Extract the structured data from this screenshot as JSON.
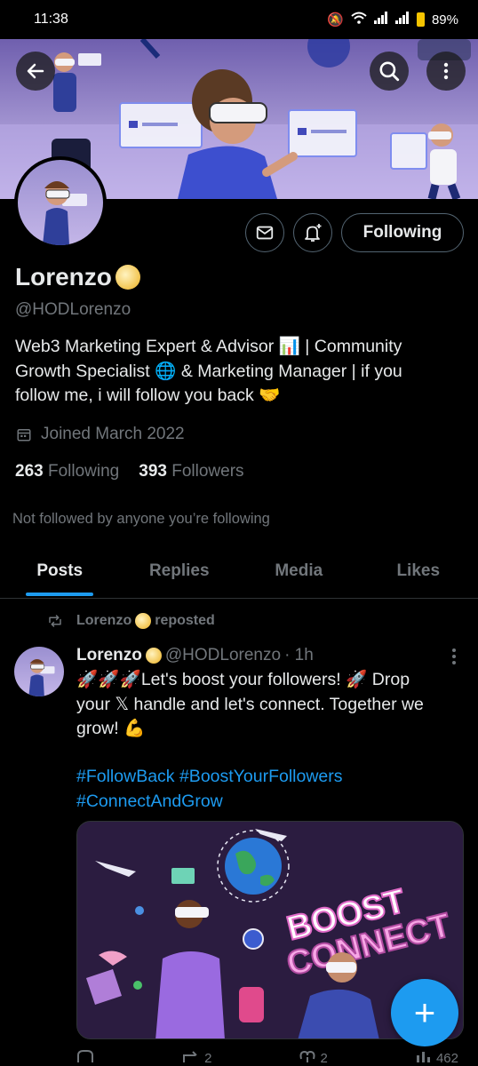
{
  "status_bar": {
    "time": "11:38",
    "battery": "89%"
  },
  "profile": {
    "name": "Lorenzo",
    "handle": "@HODLorenzo",
    "bio_lines": [
      "Web3 Marketing Expert & Advisor 📊 | Community",
      "Growth Specialist 🌐 &  Marketing Manager |  if you",
      "follow me, i will follow you back 🤝"
    ],
    "joined": "Joined March 2022",
    "following_count": "263",
    "following_label": "Following",
    "followers_count": "393",
    "followers_label": "Followers",
    "not_followed_text": "Not followed by anyone you’re following"
  },
  "actions": {
    "following_button": "Following"
  },
  "tabs": [
    {
      "label": "Posts",
      "active": true
    },
    {
      "label": "Replies",
      "active": false
    },
    {
      "label": "Media",
      "active": false
    },
    {
      "label": "Likes",
      "active": false
    }
  ],
  "post": {
    "repost_name": "Lorenzo",
    "repost_label": "reposted",
    "author_name": "Lorenzo",
    "author_handle": "@HODLorenzo",
    "time": "· 1h",
    "text_lines": [
      "🚀🚀🚀Let's boost your followers! 🚀 Drop",
      "your 𝕏 handle and let's connect. Together we",
      "grow! 💪"
    ],
    "hashtag_lines": [
      "#FollowBack #BoostYourFollowers",
      "#ConnectAndGrow"
    ],
    "image_text": {
      "line1": "BOOST",
      "line2": "CONNECT"
    },
    "reply_count": "",
    "repost_count": "2",
    "like_count": "2",
    "view_count": "462"
  },
  "fab_label": "+",
  "colors": {
    "accent": "#1d9bf0",
    "muted": "#71767b",
    "text": "#e7e9ea",
    "background": "#000000"
  }
}
